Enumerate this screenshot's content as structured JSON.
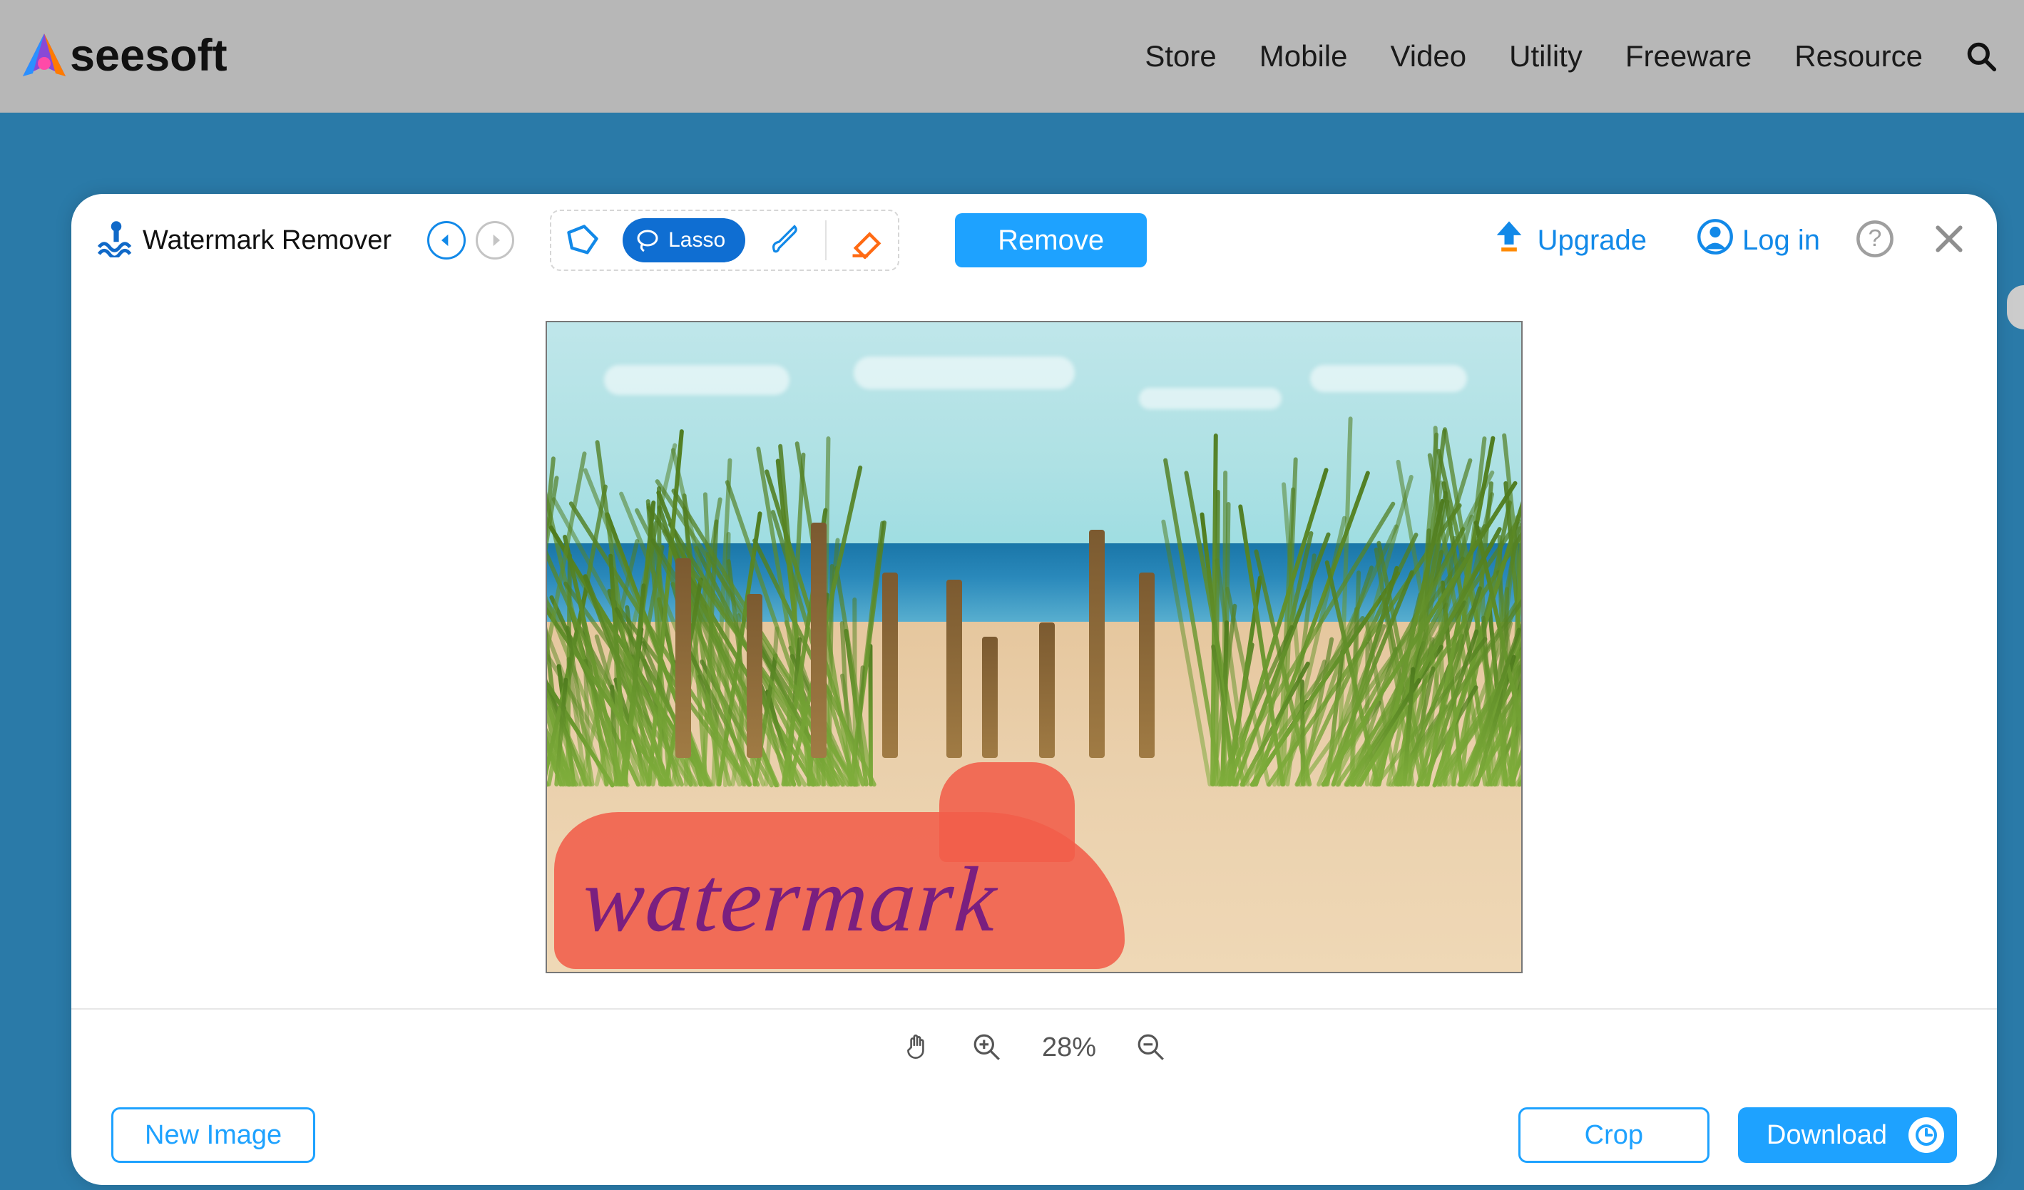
{
  "site": {
    "brand": "seesoft",
    "nav": [
      "Store",
      "Mobile",
      "Video",
      "Utility",
      "Freeware",
      "Resource"
    ]
  },
  "app": {
    "title": "Watermark Remover",
    "tools": {
      "lasso_label": "Lasso"
    },
    "actions": {
      "remove": "Remove",
      "upgrade": "Upgrade",
      "login": "Log in"
    },
    "zoom": {
      "value": "28%"
    },
    "footer": {
      "new_image": "New Image",
      "crop": "Crop",
      "download": "Download"
    },
    "canvas": {
      "watermark_text": "watermark"
    }
  }
}
